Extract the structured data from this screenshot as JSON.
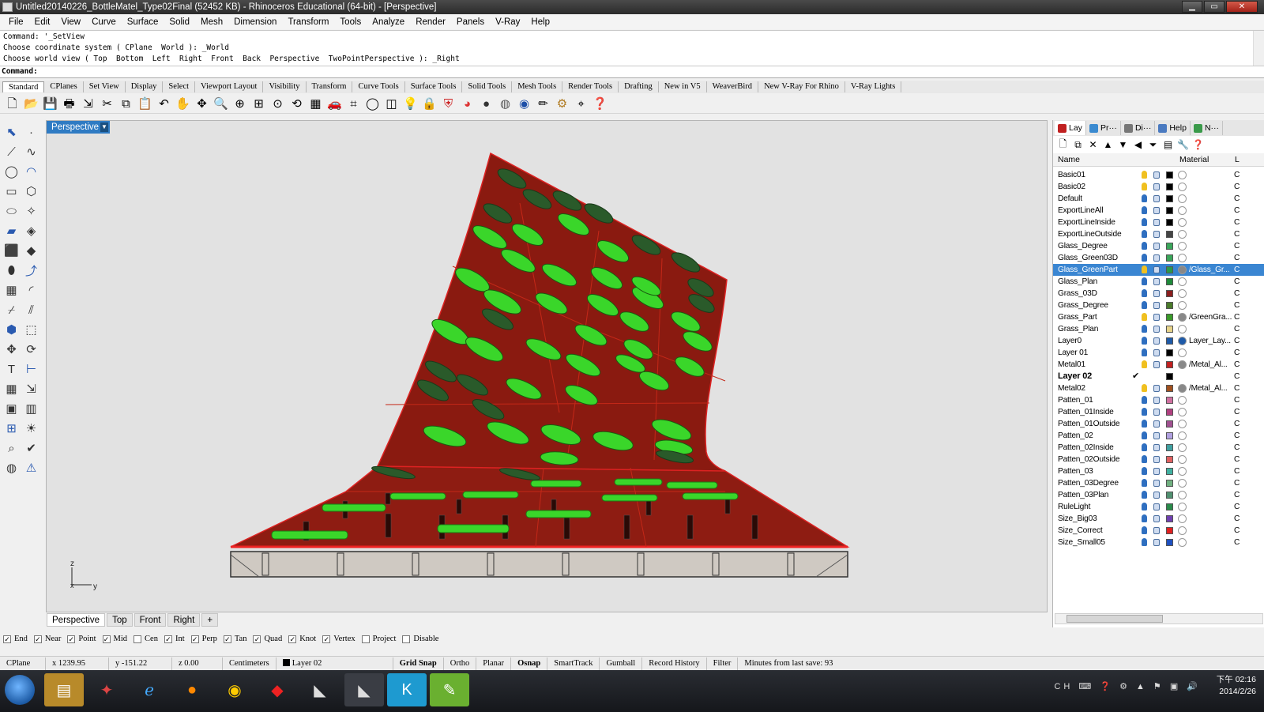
{
  "window": {
    "title": "Untitled20140226_BottleMatel_Type02Final (52452 KB) - Rhinoceros Educational (64-bit) - [Perspective]"
  },
  "menu": [
    "File",
    "Edit",
    "View",
    "Curve",
    "Surface",
    "Solid",
    "Mesh",
    "Dimension",
    "Transform",
    "Tools",
    "Analyze",
    "Render",
    "Panels",
    "V-Ray",
    "Help"
  ],
  "command": {
    "history": [
      "Command: '_SetView",
      "Choose coordinate system ( CPlane  World ): _World",
      "Choose world view ( Top  Bottom  Left  Right  Front  Back  Perspective  TwoPointPerspective ): _Right"
    ],
    "prompt": "Command:",
    "value": ""
  },
  "toolbar_tabs": [
    "Standard",
    "CPlanes",
    "Set View",
    "Display",
    "Select",
    "Viewport Layout",
    "Visibility",
    "Transform",
    "Curve Tools",
    "Surface Tools",
    "Solid Tools",
    "Mesh Tools",
    "Render Tools",
    "Drafting",
    "New in V5",
    "WeaverBird",
    "New V-Ray For Rhino",
    "V-Ray Lights"
  ],
  "toolbar_icons": [
    "new-file-icon",
    "open-icon",
    "save-icon",
    "print-icon",
    "import-icon",
    "cut-icon",
    "copy-icon",
    "paste-icon",
    "undo-icon",
    "pan-icon",
    "move-icon",
    "zoom-icon",
    "zoom-window-icon",
    "zoom-extents-icon",
    "zoom-selected-icon",
    "rotate-view-icon",
    "four-views-icon",
    "car-icon",
    "grid-icon",
    "circle-icon",
    "snap-icon",
    "light-icon",
    "lock-icon",
    "shield-icon",
    "color-wheel-icon",
    "sphere-icon",
    "material-ball-icon",
    "render-sphere-icon",
    "pencil-icon",
    "gear-icon",
    "camera-icon",
    "help-icon"
  ],
  "viewport": {
    "active_tab": "Perspective",
    "axes": {
      "z": "z",
      "x": "x",
      "y": "y"
    },
    "tabs": [
      "Perspective",
      "Top",
      "Front",
      "Right"
    ],
    "add_tab": "+"
  },
  "osnaps": [
    {
      "label": "End",
      "checked": true
    },
    {
      "label": "Near",
      "checked": true
    },
    {
      "label": "Point",
      "checked": true
    },
    {
      "label": "Mid",
      "checked": true
    },
    {
      "label": "Cen",
      "checked": false
    },
    {
      "label": "Int",
      "checked": true
    },
    {
      "label": "Perp",
      "checked": true
    },
    {
      "label": "Tan",
      "checked": true
    },
    {
      "label": "Quad",
      "checked": true
    },
    {
      "label": "Knot",
      "checked": true
    },
    {
      "label": "Vertex",
      "checked": true
    },
    {
      "label": "Project",
      "checked": false
    },
    {
      "label": "Disable",
      "checked": false
    }
  ],
  "status": {
    "cplane": "CPlane",
    "x": "x 1239.95",
    "y": "y -151.22",
    "z": "z 0.00",
    "units": "Centimeters",
    "layer": "Layer 02",
    "grid_snap": "Grid Snap",
    "ortho": "Ortho",
    "planar": "Planar",
    "osnap": "Osnap",
    "smarttrack": "SmartTrack",
    "gumball": "Gumball",
    "record_history": "Record History",
    "filter": "Filter",
    "minutes": "Minutes from last save: 93"
  },
  "panel": {
    "tabs": [
      "Lay",
      "Pr···",
      "Di···",
      "Help",
      "N···"
    ],
    "header": {
      "name": "Name",
      "material": "Material",
      "extra": "L"
    },
    "layers": [
      {
        "name": "Basic01",
        "bulb": "on",
        "color": "#000000",
        "material": "",
        "extra": "C"
      },
      {
        "name": "Basic02",
        "bulb": "on",
        "color": "#000000",
        "material": "",
        "extra": "C"
      },
      {
        "name": "Default",
        "bulb": "off",
        "color": "#000000",
        "material": "",
        "extra": "C"
      },
      {
        "name": "ExportLineAll",
        "bulb": "off",
        "color": "#000000",
        "material": "",
        "extra": "C"
      },
      {
        "name": "ExportLineInside",
        "bulb": "off",
        "color": "#000000",
        "material": "",
        "extra": "C"
      },
      {
        "name": "ExportLineOutside",
        "bulb": "off",
        "color": "#444444",
        "material": "",
        "extra": "C"
      },
      {
        "name": "Glass_Degree",
        "bulb": "off",
        "color": "#3aa65a",
        "material": "",
        "extra": "C"
      },
      {
        "name": "Glass_Green03D",
        "bulb": "off",
        "color": "#3aa65a",
        "material": "",
        "extra": "C"
      },
      {
        "name": "Glass_GreenPart",
        "bulb": "on",
        "color": "#2a9a4a",
        "material": "/Glass_Gr...",
        "extra": "C",
        "selected": true
      },
      {
        "name": "Glass_Plan",
        "bulb": "off",
        "color": "#1e8a3a",
        "material": "",
        "extra": "C"
      },
      {
        "name": "Grass_03D",
        "bulb": "off",
        "color": "#8a1e1e",
        "material": "",
        "extra": "C"
      },
      {
        "name": "Grass_Degree",
        "bulb": "off",
        "color": "#4a7a2a",
        "material": "",
        "extra": "C"
      },
      {
        "name": "Grass_Part",
        "bulb": "on",
        "color": "#3a9a2a",
        "material": "/GreenGra...",
        "extra": "C"
      },
      {
        "name": "Grass_Plan",
        "bulb": "off",
        "color": "#e8d48a",
        "material": "",
        "extra": "C"
      },
      {
        "name": "Layer0",
        "bulb": "off",
        "color": "#1e5aa8",
        "material": "Layer_Lay...",
        "extra": "C"
      },
      {
        "name": "Layer 01",
        "bulb": "off",
        "color": "#000000",
        "material": "",
        "extra": "C"
      },
      {
        "name": "Metal01",
        "bulb": "on",
        "color": "#c02020",
        "material": "/Metal_Al...",
        "extra": "C"
      },
      {
        "name": "Layer 02",
        "bulb": "",
        "color": "#000000",
        "material": "",
        "extra": "C",
        "current": true,
        "check": "✔"
      },
      {
        "name": "Metal02",
        "bulb": "on",
        "color": "#a0501e",
        "material": "/Metal_Al...",
        "extra": "C"
      },
      {
        "name": "Patten_01",
        "bulb": "off",
        "color": "#d070a0",
        "material": "",
        "extra": "C"
      },
      {
        "name": "Patten_01Inside",
        "bulb": "off",
        "color": "#b04080",
        "material": "",
        "extra": "C"
      },
      {
        "name": "Patten_01Outside",
        "bulb": "off",
        "color": "#a05090",
        "material": "",
        "extra": "C"
      },
      {
        "name": "Patten_02",
        "bulb": "off",
        "color": "#b0a0e0",
        "material": "",
        "extra": "C"
      },
      {
        "name": "Patten_02Inside",
        "bulb": "off",
        "color": "#40a0a0",
        "material": "",
        "extra": "C"
      },
      {
        "name": "Patten_02Outside",
        "bulb": "off",
        "color": "#e06060",
        "material": "",
        "extra": "C"
      },
      {
        "name": "Patten_03",
        "bulb": "off",
        "color": "#40b0a0",
        "material": "",
        "extra": "C"
      },
      {
        "name": "Patten_03Degree",
        "bulb": "off",
        "color": "#70b080",
        "material": "",
        "extra": "C"
      },
      {
        "name": "Patten_03Plan",
        "bulb": "off",
        "color": "#509070",
        "material": "",
        "extra": "C"
      },
      {
        "name": "RuleLight",
        "bulb": "off",
        "color": "#2a8a4a",
        "material": "",
        "extra": "C"
      },
      {
        "name": "Size_Big03",
        "bulb": "off",
        "color": "#7040b0",
        "material": "",
        "extra": "C"
      },
      {
        "name": "Size_Correct",
        "bulb": "off",
        "color": "#e02020",
        "material": "",
        "extra": "C"
      },
      {
        "name": "Size_Small05",
        "bulb": "off",
        "color": "#1e50c0",
        "material": "",
        "extra": "C"
      }
    ]
  },
  "taskbar": {
    "time": "下午 02:16",
    "date": "2014/2/26",
    "lang": "CH"
  },
  "colors": {
    "accent": "#2f7bc3",
    "model_red": "#8a1a10",
    "bottle_green": "#3ad62a"
  }
}
